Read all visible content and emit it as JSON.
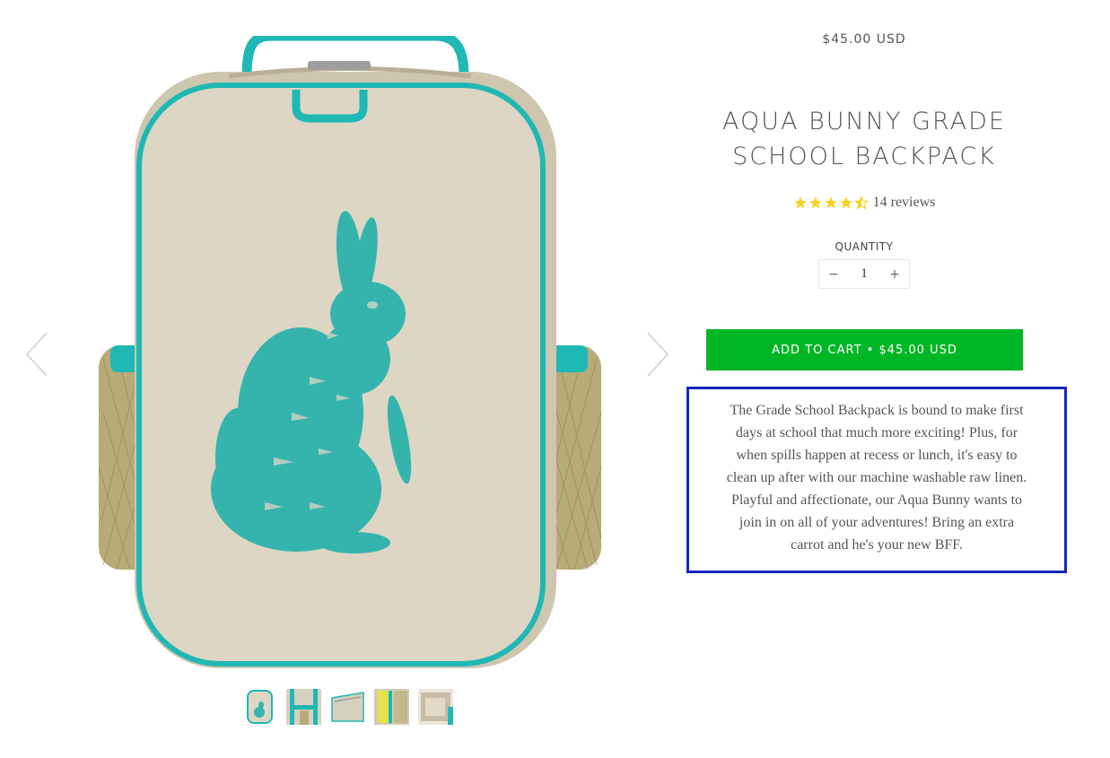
{
  "product": {
    "price": "$45.00 USD",
    "title": "AQUA BUNNY GRADE SCHOOL BACKPACK",
    "rating": 4.5,
    "reviews_label": "14 reviews",
    "quantity_label": "QUANTITY",
    "quantity_value": "1",
    "minus_label": "−",
    "plus_label": "+",
    "add_to_cart_label": "ADD TO CART • $45.00 USD",
    "description": "The Grade School Backpack is bound to make first days at school that much more exciting! Plus, for when spills happen at recess or lunch, it's easy to clean up after with our machine washable raw linen. Playful and affectionate, our Aqua Bunny wants to join in on all of your adventures! Bring an extra carrot and he's your new BFF."
  },
  "gallery": {
    "thumbnail_count": 5,
    "prev_icon": "chevron-left-icon",
    "next_icon": "chevron-right-icon"
  },
  "colors": {
    "accent_aqua": "#1fb8b4",
    "linen": "#ddd6c4",
    "button_green": "#00b624",
    "star_yellow": "#f5d31e",
    "highlight_border": "#1428b8"
  }
}
